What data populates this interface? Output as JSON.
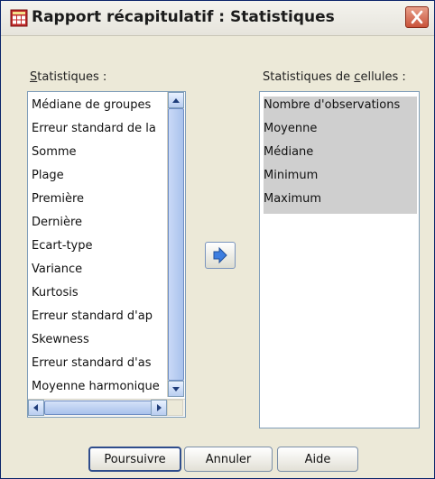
{
  "dialog": {
    "title": "Rapport récapitulatif : Statistiques"
  },
  "left_list": {
    "label_prefix": "S",
    "label_rest": "tatistiques :",
    "items": [
      "Médiane de groupes",
      "Erreur standard de la",
      "Somme",
      "Plage",
      "Première",
      "Dernière",
      "Ecart-type",
      "Variance",
      "Kurtosis",
      "Erreur standard d'ap",
      "Skewness",
      "Erreur standard d'as",
      "Moyenne harmonique"
    ]
  },
  "right_list": {
    "label_prefix": "Statistiques de ",
    "label_underlined": "c",
    "label_rest": "ellules :",
    "items": [
      "Nombre d'observations",
      "Moyenne",
      "Médiane",
      "Minimum",
      "Maximum"
    ]
  },
  "buttons": {
    "continue": "Poursuivre",
    "cancel": "Annuler",
    "help": "Aide"
  },
  "icons": {
    "title_icon": "table-grid-icon",
    "close": "close-icon",
    "move": "arrow-right-icon"
  },
  "colors": {
    "selection": "#cfcfcf",
    "accent": "#3d7ee0",
    "close": "#c9523a"
  }
}
